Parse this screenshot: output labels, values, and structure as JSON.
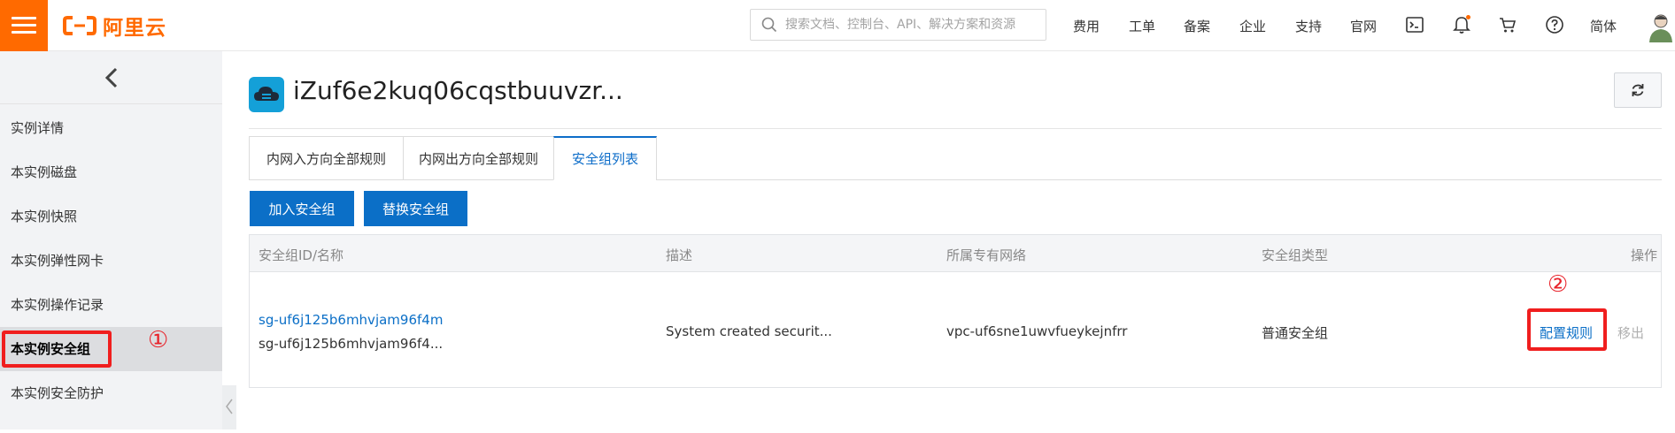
{
  "header": {
    "logo_text": "阿里云",
    "search_placeholder": "搜索文档、控制台、API、解决方案和资源",
    "nav": [
      "费用",
      "工单",
      "备案",
      "企业",
      "支持",
      "官网"
    ],
    "language": "简体",
    "brand_color": "#ff6a00"
  },
  "sidebar": {
    "items": [
      {
        "label": "实例详情"
      },
      {
        "label": "本实例磁盘"
      },
      {
        "label": "本实例快照"
      },
      {
        "label": "本实例弹性网卡"
      },
      {
        "label": "本实例操作记录"
      },
      {
        "label": "本实例安全组"
      },
      {
        "label": "本实例安全防护"
      }
    ],
    "active_index": 5,
    "marker": "①"
  },
  "main": {
    "instance_title": "iZuf6e2kuq06cqstbuuvzr...",
    "tabs": [
      {
        "label": "内网入方向全部规则"
      },
      {
        "label": "内网出方向全部规则"
      },
      {
        "label": "安全组列表"
      }
    ],
    "active_tab": 2,
    "buttons": {
      "join": "加入安全组",
      "replace": "替换安全组"
    },
    "table": {
      "headers": {
        "id_name": "安全组ID/名称",
        "desc": "描述",
        "vpc": "所属专有网络",
        "type": "安全组类型",
        "ops": "操作"
      },
      "rows": [
        {
          "id": "sg-uf6j125b6mhvjam96f4m",
          "name": "sg-uf6j125b6mhvjam96f4...",
          "desc": "System created securit...",
          "vpc": "vpc-uf6sne1uwvfueykejnfrr",
          "type": "普通安全组",
          "op_config": "配置规则",
          "op_remove": "移出"
        }
      ],
      "marker": "②"
    },
    "accent_color": "#0b6fc7",
    "annotation_color": "#f01e1e"
  }
}
